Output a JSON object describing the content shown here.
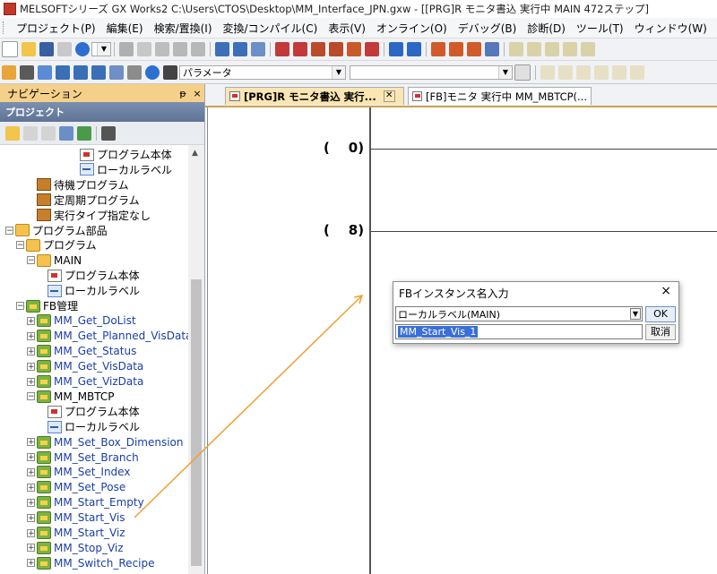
{
  "window": {
    "title": "MELSOFTシリーズ GX Works2 C:\\Users\\CTOS\\Desktop\\MM_Interface_JPN.gxw - [[PRG]R モニタ書込 実行中 MAIN 472ステップ]"
  },
  "menu": [
    "プロジェクト(P)",
    "編集(E)",
    "検索/置換(I)",
    "変換/コンパイル(C)",
    "表示(V)",
    "オンライン(O)",
    "デバッグ(B)",
    "診断(D)",
    "ツール(T)",
    "ウィンドウ(W)"
  ],
  "toolbar": {
    "parameter_combo": "パラメータ"
  },
  "navigation": {
    "header": "ナビゲーション",
    "pin": "ᵽ",
    "close": "×",
    "project_header": "プロジェクト",
    "tree": [
      {
        "label": "プログラム本体",
        "icon": "program-icon",
        "expand": "",
        "blue": false
      },
      {
        "label": "ローカルラベル",
        "icon": "local-label-icon",
        "expand": "",
        "blue": false
      },
      {
        "label": "待機プログラム",
        "icon": "folder-icon",
        "expand": "",
        "blue": false
      },
      {
        "label": "定周期プログラム",
        "icon": "folder-icon",
        "expand": "",
        "blue": false
      },
      {
        "label": "実行タイプ指定なし",
        "icon": "folder-icon",
        "expand": "",
        "blue": false
      },
      {
        "label": "プログラム部品",
        "icon": "folder-icon",
        "expand": "−",
        "blue": false
      },
      {
        "label": "プログラム",
        "icon": "folder-icon",
        "expand": "−",
        "blue": false
      },
      {
        "label": "MAIN",
        "icon": "folder-icon",
        "expand": "−",
        "blue": false
      },
      {
        "label": "プログラム本体",
        "icon": "program-icon",
        "expand": "",
        "blue": false
      },
      {
        "label": "ローカルラベル",
        "icon": "local-label-icon",
        "expand": "",
        "blue": false
      },
      {
        "label": "FB管理",
        "icon": "fb-folder-icon",
        "expand": "−",
        "blue": false
      },
      {
        "label": "MM_Get_DoList",
        "icon": "fb-folder-icon",
        "expand": "+",
        "blue": true
      },
      {
        "label": "MM_Get_Planned_VisData",
        "icon": "fb-folder-icon",
        "expand": "+",
        "blue": true
      },
      {
        "label": "MM_Get_Status",
        "icon": "fb-folder-icon",
        "expand": "+",
        "blue": true
      },
      {
        "label": "MM_Get_VisData",
        "icon": "fb-folder-icon",
        "expand": "+",
        "blue": true
      },
      {
        "label": "MM_Get_VizData",
        "icon": "fb-folder-icon",
        "expand": "+",
        "blue": true
      },
      {
        "label": "MM_MBTCP",
        "icon": "fb-folder-icon",
        "expand": "−",
        "blue": false
      },
      {
        "label": "プログラム本体",
        "icon": "program-icon",
        "expand": "",
        "blue": false
      },
      {
        "label": "ローカルラベル",
        "icon": "local-label-icon",
        "expand": "",
        "blue": false
      },
      {
        "label": "MM_Set_Box_Dimension",
        "icon": "fb-folder-icon",
        "expand": "+",
        "blue": true
      },
      {
        "label": "MM_Set_Branch",
        "icon": "fb-folder-icon",
        "expand": "+",
        "blue": true
      },
      {
        "label": "MM_Set_Index",
        "icon": "fb-folder-icon",
        "expand": "+",
        "blue": true
      },
      {
        "label": "MM_Set_Pose",
        "icon": "fb-folder-icon",
        "expand": "+",
        "blue": true
      },
      {
        "label": "MM_Start_Empty",
        "icon": "fb-folder-icon",
        "expand": "+",
        "blue": true
      },
      {
        "label": "MM_Start_Vis",
        "icon": "fb-folder-icon",
        "expand": "+",
        "blue": true
      },
      {
        "label": "MM_Start_Viz",
        "icon": "fb-folder-icon",
        "expand": "+",
        "blue": true
      },
      {
        "label": "MM_Stop_Viz",
        "icon": "fb-folder-icon",
        "expand": "+",
        "blue": true
      },
      {
        "label": "MM_Switch_Recipe",
        "icon": "fb-folder-icon",
        "expand": "+",
        "blue": true
      }
    ]
  },
  "tabs": [
    {
      "label": "[PRG]R モニタ書込 実行...",
      "active": true
    },
    {
      "label": "[FB]モニタ 実行中 MM_MBTCP(...",
      "active": false
    }
  ],
  "editor": {
    "steps": [
      "0",
      "8"
    ]
  },
  "dialog": {
    "title": "FBインスタンス名入力",
    "close": "×",
    "scope_value": "ローカルラベル(MAIN)",
    "ok_label": "OK",
    "name_value": "MM_Start_Vis_1",
    "cancel_label": "取消"
  },
  "colors": {
    "annotation_arrow": "#f0a030",
    "nav_header": "#f5d08a",
    "fb_link_text": "#1a3ea8"
  }
}
